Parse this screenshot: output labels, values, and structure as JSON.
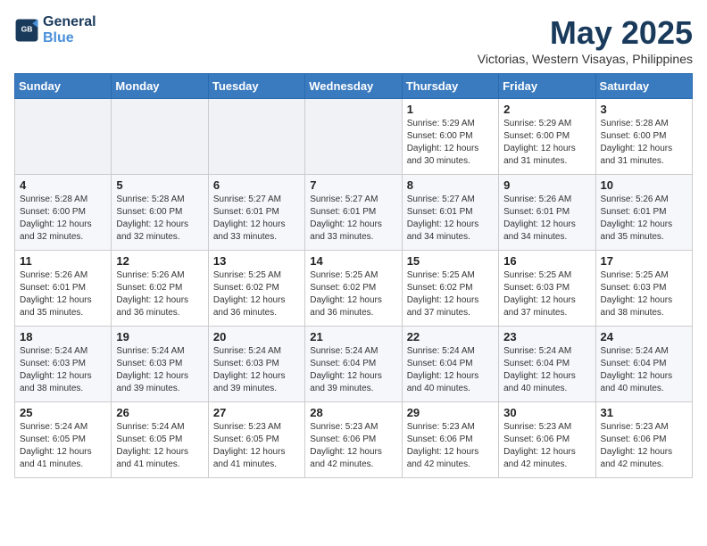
{
  "logo": {
    "line1": "General",
    "line2": "Blue"
  },
  "title": "May 2025",
  "subtitle": "Victorias, Western Visayas, Philippines",
  "days_of_week": [
    "Sunday",
    "Monday",
    "Tuesday",
    "Wednesday",
    "Thursday",
    "Friday",
    "Saturday"
  ],
  "weeks": [
    [
      {
        "day": "",
        "info": ""
      },
      {
        "day": "",
        "info": ""
      },
      {
        "day": "",
        "info": ""
      },
      {
        "day": "",
        "info": ""
      },
      {
        "day": "1",
        "info": "Sunrise: 5:29 AM\nSunset: 6:00 PM\nDaylight: 12 hours\nand 30 minutes."
      },
      {
        "day": "2",
        "info": "Sunrise: 5:29 AM\nSunset: 6:00 PM\nDaylight: 12 hours\nand 31 minutes."
      },
      {
        "day": "3",
        "info": "Sunrise: 5:28 AM\nSunset: 6:00 PM\nDaylight: 12 hours\nand 31 minutes."
      }
    ],
    [
      {
        "day": "4",
        "info": "Sunrise: 5:28 AM\nSunset: 6:00 PM\nDaylight: 12 hours\nand 32 minutes."
      },
      {
        "day": "5",
        "info": "Sunrise: 5:28 AM\nSunset: 6:00 PM\nDaylight: 12 hours\nand 32 minutes."
      },
      {
        "day": "6",
        "info": "Sunrise: 5:27 AM\nSunset: 6:01 PM\nDaylight: 12 hours\nand 33 minutes."
      },
      {
        "day": "7",
        "info": "Sunrise: 5:27 AM\nSunset: 6:01 PM\nDaylight: 12 hours\nand 33 minutes."
      },
      {
        "day": "8",
        "info": "Sunrise: 5:27 AM\nSunset: 6:01 PM\nDaylight: 12 hours\nand 34 minutes."
      },
      {
        "day": "9",
        "info": "Sunrise: 5:26 AM\nSunset: 6:01 PM\nDaylight: 12 hours\nand 34 minutes."
      },
      {
        "day": "10",
        "info": "Sunrise: 5:26 AM\nSunset: 6:01 PM\nDaylight: 12 hours\nand 35 minutes."
      }
    ],
    [
      {
        "day": "11",
        "info": "Sunrise: 5:26 AM\nSunset: 6:01 PM\nDaylight: 12 hours\nand 35 minutes."
      },
      {
        "day": "12",
        "info": "Sunrise: 5:26 AM\nSunset: 6:02 PM\nDaylight: 12 hours\nand 36 minutes."
      },
      {
        "day": "13",
        "info": "Sunrise: 5:25 AM\nSunset: 6:02 PM\nDaylight: 12 hours\nand 36 minutes."
      },
      {
        "day": "14",
        "info": "Sunrise: 5:25 AM\nSunset: 6:02 PM\nDaylight: 12 hours\nand 36 minutes."
      },
      {
        "day": "15",
        "info": "Sunrise: 5:25 AM\nSunset: 6:02 PM\nDaylight: 12 hours\nand 37 minutes."
      },
      {
        "day": "16",
        "info": "Sunrise: 5:25 AM\nSunset: 6:03 PM\nDaylight: 12 hours\nand 37 minutes."
      },
      {
        "day": "17",
        "info": "Sunrise: 5:25 AM\nSunset: 6:03 PM\nDaylight: 12 hours\nand 38 minutes."
      }
    ],
    [
      {
        "day": "18",
        "info": "Sunrise: 5:24 AM\nSunset: 6:03 PM\nDaylight: 12 hours\nand 38 minutes."
      },
      {
        "day": "19",
        "info": "Sunrise: 5:24 AM\nSunset: 6:03 PM\nDaylight: 12 hours\nand 39 minutes."
      },
      {
        "day": "20",
        "info": "Sunrise: 5:24 AM\nSunset: 6:03 PM\nDaylight: 12 hours\nand 39 minutes."
      },
      {
        "day": "21",
        "info": "Sunrise: 5:24 AM\nSunset: 6:04 PM\nDaylight: 12 hours\nand 39 minutes."
      },
      {
        "day": "22",
        "info": "Sunrise: 5:24 AM\nSunset: 6:04 PM\nDaylight: 12 hours\nand 40 minutes."
      },
      {
        "day": "23",
        "info": "Sunrise: 5:24 AM\nSunset: 6:04 PM\nDaylight: 12 hours\nand 40 minutes."
      },
      {
        "day": "24",
        "info": "Sunrise: 5:24 AM\nSunset: 6:04 PM\nDaylight: 12 hours\nand 40 minutes."
      }
    ],
    [
      {
        "day": "25",
        "info": "Sunrise: 5:24 AM\nSunset: 6:05 PM\nDaylight: 12 hours\nand 41 minutes."
      },
      {
        "day": "26",
        "info": "Sunrise: 5:24 AM\nSunset: 6:05 PM\nDaylight: 12 hours\nand 41 minutes."
      },
      {
        "day": "27",
        "info": "Sunrise: 5:23 AM\nSunset: 6:05 PM\nDaylight: 12 hours\nand 41 minutes."
      },
      {
        "day": "28",
        "info": "Sunrise: 5:23 AM\nSunset: 6:06 PM\nDaylight: 12 hours\nand 42 minutes."
      },
      {
        "day": "29",
        "info": "Sunrise: 5:23 AM\nSunset: 6:06 PM\nDaylight: 12 hours\nand 42 minutes."
      },
      {
        "day": "30",
        "info": "Sunrise: 5:23 AM\nSunset: 6:06 PM\nDaylight: 12 hours\nand 42 minutes."
      },
      {
        "day": "31",
        "info": "Sunrise: 5:23 AM\nSunset: 6:06 PM\nDaylight: 12 hours\nand 42 minutes."
      }
    ]
  ]
}
